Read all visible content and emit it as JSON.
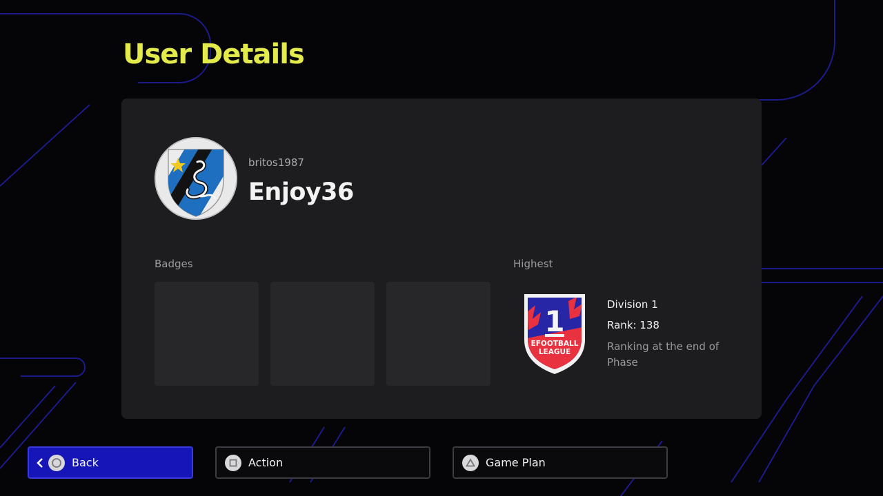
{
  "header": {
    "title": "User Details"
  },
  "profile": {
    "user_id": "britos1987",
    "display_name": "Enjoy36",
    "avatar_icon": "inter-milan-crest"
  },
  "badges": {
    "label": "Badges",
    "slots": [
      "",
      "",
      ""
    ]
  },
  "highest": {
    "label": "Highest",
    "emblem_number": "1",
    "emblem_line1": "EFOOTBALL",
    "emblem_line2": "LEAGUE",
    "division": "Division 1",
    "rank": "Rank: 138",
    "note": "Ranking at the end of Phase"
  },
  "footer": {
    "back_label": "Back",
    "action_label": "Action",
    "game_plan_label": "Game Plan"
  },
  "colors": {
    "title": "#e3ea4c",
    "panel": "#1d1d20",
    "active_button": "#1616b8",
    "accent_lines": "#1e1ea0"
  }
}
